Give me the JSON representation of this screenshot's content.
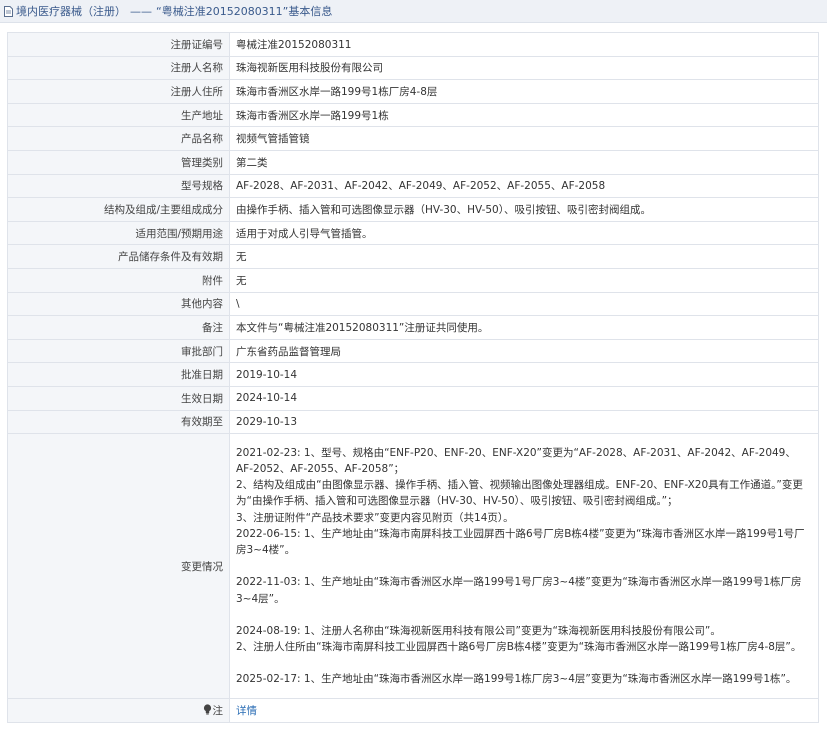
{
  "header": {
    "category": "境内医疗器械（注册）",
    "separator": "——",
    "title": "“粤械注准20152080311”基本信息"
  },
  "rows": [
    {
      "label": "注册证编号",
      "value": "粤械注准20152080311"
    },
    {
      "label": "注册人名称",
      "value": "珠海视新医用科技股份有限公司"
    },
    {
      "label": "注册人住所",
      "value": "珠海市香洲区水岸一路199号1栋厂房4-8层"
    },
    {
      "label": "生产地址",
      "value": "珠海市香洲区水岸一路199号1栋"
    },
    {
      "label": "产品名称",
      "value": "视频气管插管镜"
    },
    {
      "label": "管理类别",
      "value": "第二类"
    },
    {
      "label": "型号规格",
      "value": "AF-2028、AF-2031、AF-2042、AF-2049、AF-2052、AF-2055、AF-2058"
    },
    {
      "label": "结构及组成/主要组成成分",
      "value": "由操作手柄、插入管和可选图像显示器（HV-30、HV-50）、吸引按钮、吸引密封阀组成。"
    },
    {
      "label": "适用范围/预期用途",
      "value": "适用于对成人引导气管插管。"
    },
    {
      "label": "产品储存条件及有效期",
      "value": "无"
    },
    {
      "label": "附件",
      "value": "无"
    },
    {
      "label": "其他内容",
      "value": "\\"
    },
    {
      "label": "备注",
      "value": "本文件与“粤械注准20152080311”注册证共同使用。"
    },
    {
      "label": "审批部门",
      "value": "广东省药品监督管理局"
    },
    {
      "label": "批准日期",
      "value": "2019-10-14"
    },
    {
      "label": "生效日期",
      "value": "2024-10-14"
    },
    {
      "label": "有效期至",
      "value": "2029-10-13"
    }
  ],
  "changes": {
    "label": "变更情况",
    "p1": "2021-02-23: 1、型号、规格由“ENF-P20、ENF-20、ENF-X20”变更为“AF-2028、AF-2031、AF-2042、AF-2049、AF-2052、AF-2055、AF-2058”；",
    "p2": "2、结构及组成由“由图像显示器、操作手柄、插入管、视频输出图像处理器组成。ENF-20、ENF-X20具有工作通道。”变更为“由操作手柄、插入管和可选图像显示器（HV-30、HV-50）、吸引按钮、吸引密封阀组成。”；",
    "p3": "3、注册证附件“产品技术要求”变更内容见附页（共14页）。",
    "p4": "2022-06-15: 1、生产地址由“珠海市南屏科技工业园屏西十路6号厂房B栋4楼”变更为“珠海市香洲区水岸一路199号1号厂房3~4楼”。",
    "p5": "2022-11-03: 1、生产地址由“珠海市香洲区水岸一路199号1号厂房3~4楼”变更为“珠海市香洲区水岸一路199号1栋厂房3~4层”。",
    "p6": "2024-08-19: 1、注册人名称由“珠海视新医用科技有限公司”变更为“珠海视新医用科技股份有限公司”。",
    "p7": "2、注册人住所由“珠海市南屏科技工业园屏西十路6号厂房B栋4楼”变更为“珠海市香洲区水岸一路199号1栋厂房4-8层”。",
    "p8": "2025-02-17: 1、生产地址由“珠海市香洲区水岸一路199号1栋厂房3~4层”变更为“珠海市香洲区水岸一路199号1栋”。"
  },
  "note": {
    "label": "注",
    "link_text": "详情"
  },
  "icons": {
    "header": "document-icon",
    "note": "lightbulb-icon"
  },
  "colors": {
    "header_bg": "#eef1f6",
    "header_text": "#3a5a8c",
    "label_bg": "#f4f6f9",
    "border": "#dfe3ea",
    "link": "#2a6db5"
  }
}
